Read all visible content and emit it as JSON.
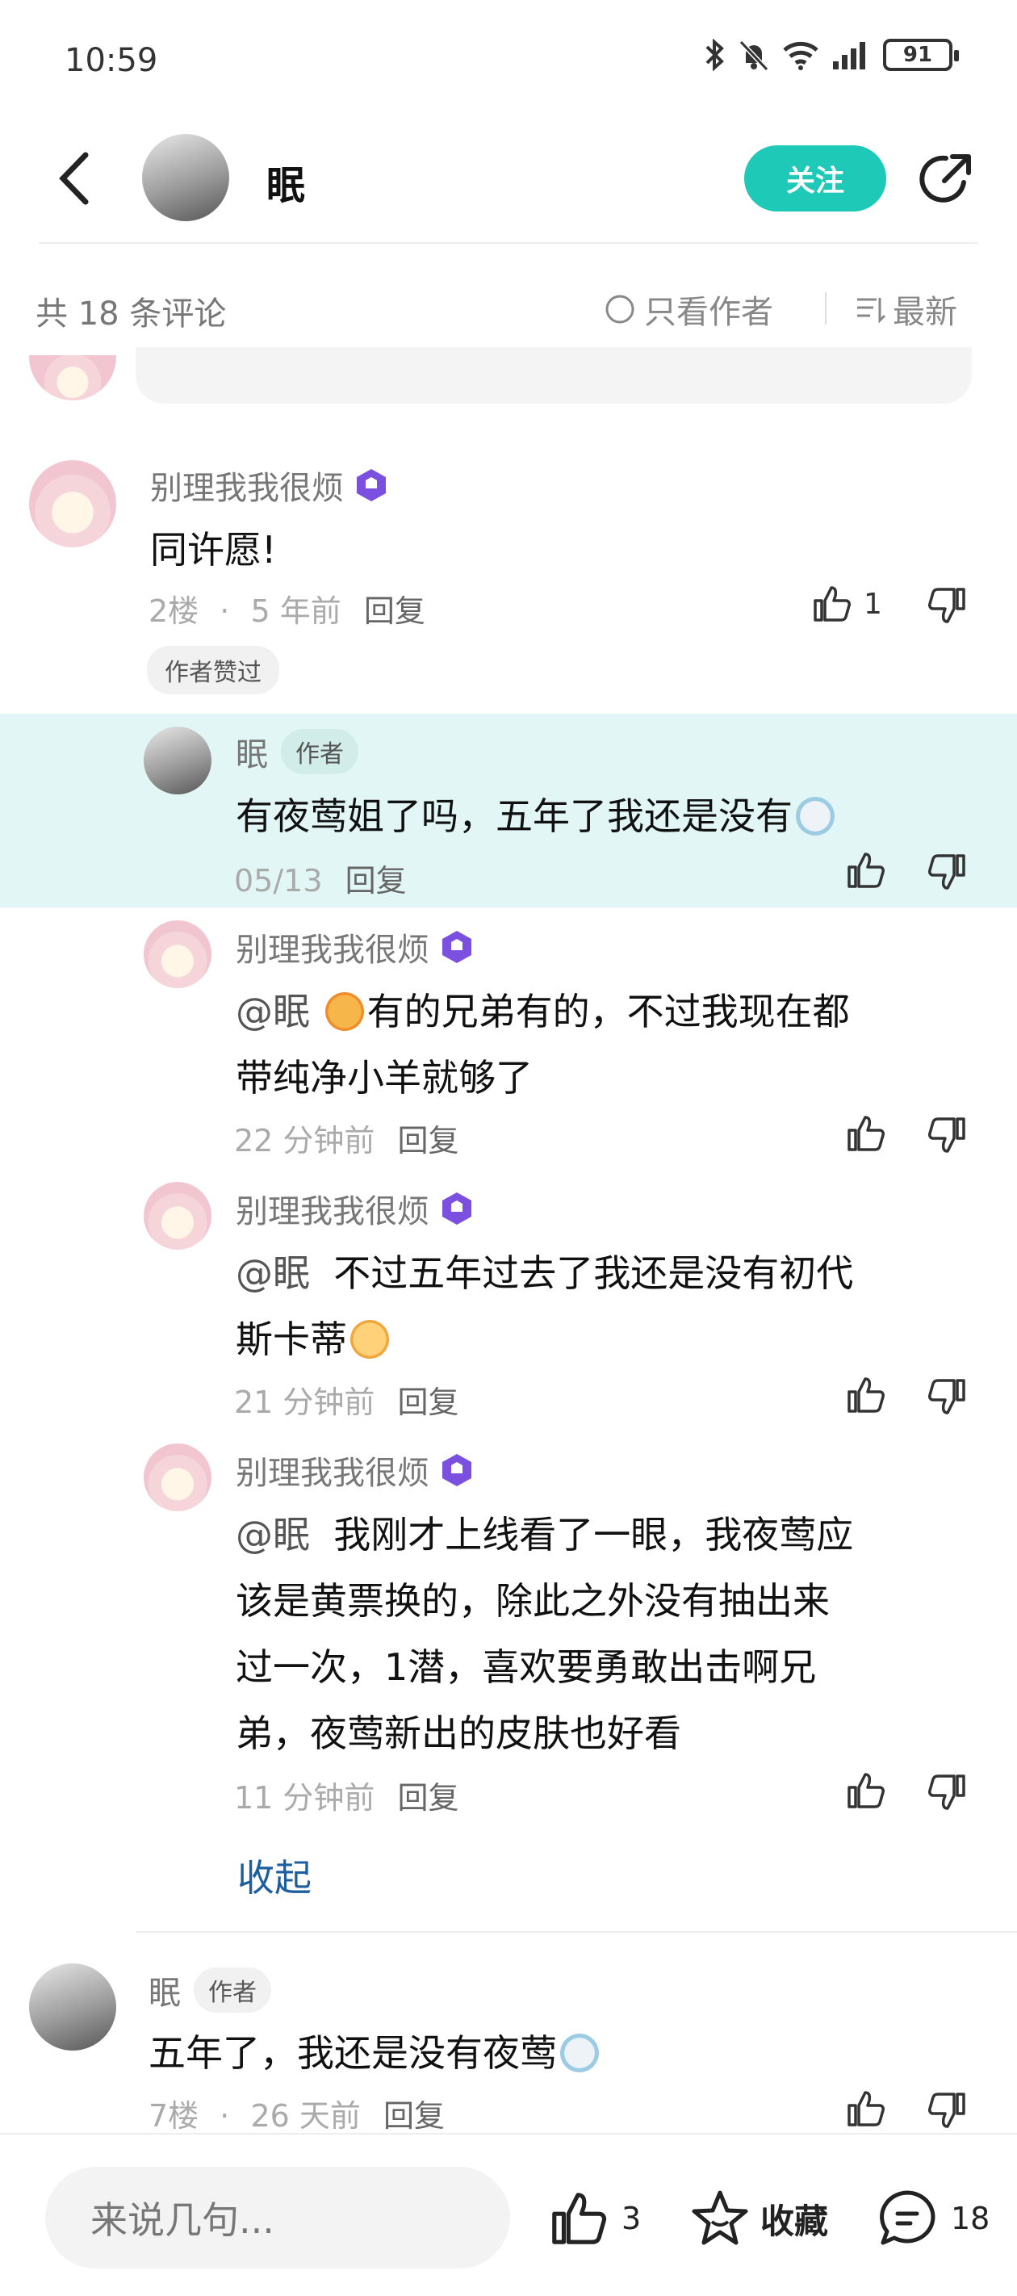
{
  "status_bar": {
    "time": "10:59",
    "battery": "91"
  },
  "header": {
    "title": "眠",
    "follow_label": "关注"
  },
  "toolbar": {
    "count_label": "共 18 条评论",
    "only_author_label": "只看作者",
    "sort_label": "最新"
  },
  "comments": [
    {
      "name": "别理我我很烦",
      "text": "同许愿!",
      "floor": "2楼",
      "time": "5 年前",
      "reply": "回复",
      "likes": "1",
      "tag": "作者赞过"
    },
    {
      "name": "眠",
      "is_author": true,
      "author_tag": "作者",
      "floor": "7楼",
      "time": "26 天前",
      "reply": "回复",
      "text": "五年了，我还是没有夜莺"
    }
  ],
  "replies": [
    {
      "name": "眠",
      "author_tag": "作者",
      "text": "有夜莺姐了吗，五年了我还是没有",
      "time": "05/13",
      "reply": "回复"
    },
    {
      "name": "别理我我很烦",
      "mention": "@眠",
      "line1": "有的兄弟有的，不过我现在都",
      "line2": "带纯净小羊就够了",
      "time": "22 分钟前",
      "reply": "回复"
    },
    {
      "name": "别理我我很烦",
      "mention": "@眠",
      "line1": "不过五年过去了我还是没有初代",
      "line2": "斯卡蒂",
      "time": "21 分钟前",
      "reply": "回复"
    },
    {
      "name": "别理我我很烦",
      "mention": "@眠",
      "line1": "我刚才上线看了一眼，我夜莺应",
      "line2": "该是黄票换的，除此之外没有抽出来",
      "line3": "过一次，1潜，喜欢要勇敢出击啊兄",
      "line4": "弟，夜莺新出的皮肤也好看",
      "time": "11 分钟前",
      "reply": "回复"
    }
  ],
  "collapse_label": "收起",
  "footer": {
    "input_placeholder": "来说几句...",
    "like_count": "3",
    "favorite_label": "收藏",
    "comment_count": "18"
  },
  "colors": {
    "accent": "#1ec9b7",
    "highlight_bg": "#e2f7f5",
    "link": "#1d5f9e",
    "badge": "#7b4fe0"
  }
}
